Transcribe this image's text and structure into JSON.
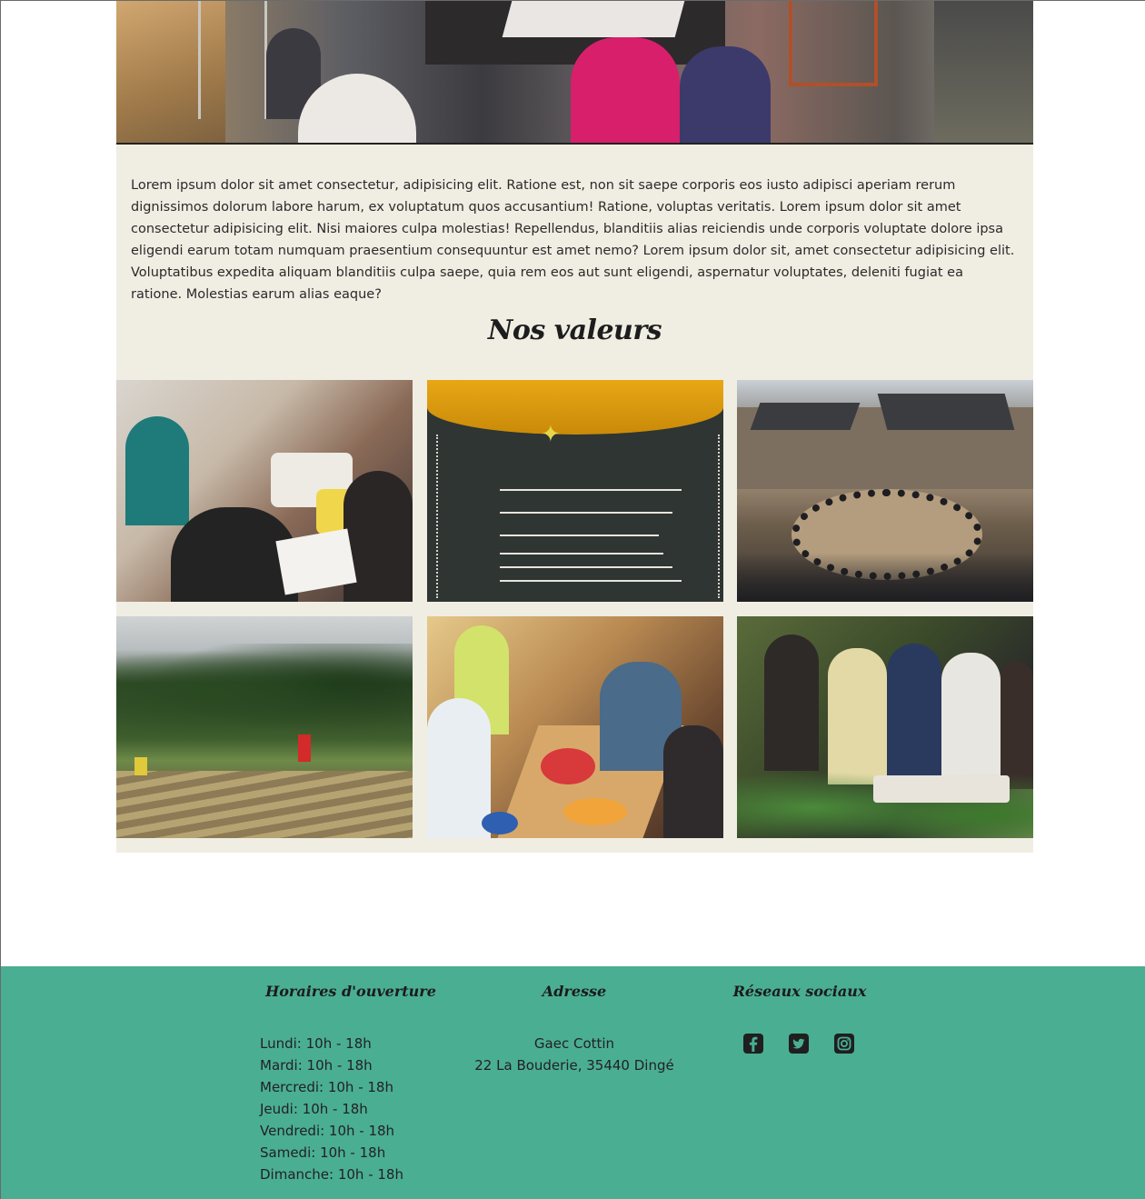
{
  "intro": {
    "text": "Lorem ipsum dolor sit amet consectetur, adipisicing elit. Ratione est, non sit saepe corporis eos iusto adipisci aperiam rerum dignissimos dolorum labore harum, ex voluptatum quos accusantium! Ratione, voluptas veritatis. Lorem ipsum dolor sit amet consectetur adipisicing elit. Nisi maiores culpa molestias! Repellendus, blanditiis alias reiciendis unde corporis voluptate dolore ipsa eligendi earum totam numquam praesentium consequuntur est amet nemo? Lorem ipsum dolor sit, amet consectetur adipisicing elit. Voluptatibus expedita aliquam blanditiis culpa saepe, quia rem eos aut sunt eligendi, aspernatur voluptates, deleniti fugiat ea ratione. Molestias earum alias eaque?"
  },
  "values": {
    "title": "Nos valeurs"
  },
  "footer": {
    "hours_title": "Horaires d'ouverture",
    "hours": [
      "Lundi: 10h - 18h",
      "Mardi: 10h - 18h",
      "Mercredi: 10h - 18h",
      "Jeudi: 10h - 18h",
      "Vendredi: 10h - 18h",
      "Samedi: 10h - 18h",
      "Dimanche: 10h - 18h"
    ],
    "address_title": "Adresse",
    "address_name": "Gaec Cottin",
    "address_line": "22 La Bouderie, 35440 Dingé",
    "social_title": "Réseaux sociaux",
    "social_icons": [
      "facebook-icon",
      "twitter-icon",
      "instagram-icon"
    ]
  },
  "colors": {
    "footer_bg": "#4aae93",
    "content_bg": "#f0ede3"
  }
}
